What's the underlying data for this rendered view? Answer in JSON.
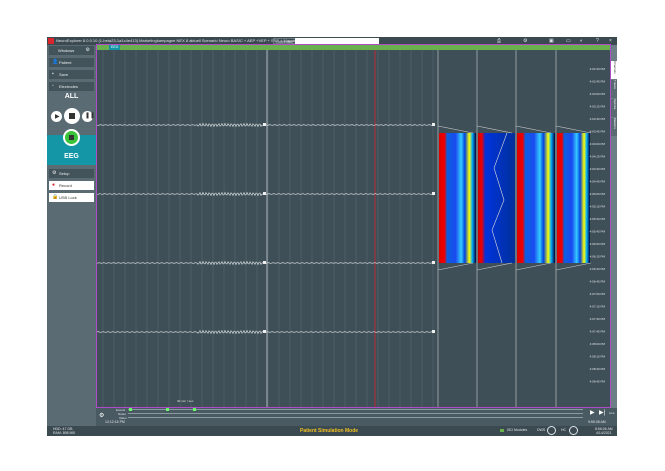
{
  "titlebar": {
    "title": "NeuroExplorer 8.0.0.10 (1-beta23-1a1c4e413)   Marketingkampagne NEX 8 aktuell Scenario Neuro BASIC + AEP +VEP + SSS + Mapping",
    "comment_label": "Comment ▾",
    "comment_value": ""
  },
  "sidebar": {
    "windows": "Windows",
    "patient": "Patient",
    "save": "Save",
    "electrodes": "Electrodes",
    "all": "ALL",
    "eeg": "EEG",
    "setup": "Setup",
    "record": "Record",
    "usb_lock": "USB Lock"
  },
  "chart": {
    "tab": "EEG",
    "scale": "30 mm / sec",
    "time_labels": [
      "4:02:30 PM",
      "4:02:45 PM",
      "4:03:00 PM",
      "4:03:15 PM",
      "4:03:30 PM",
      "4:03:45 PM",
      "4:04:00 PM",
      "4:04:15 PM",
      "4:04:30 PM",
      "4:04:45 PM",
      "4:05:00 PM",
      "4:05:15 PM",
      "4:05:30 PM",
      "4:05:45 PM",
      "4:06:00 PM",
      "4:06:15 PM",
      "4:06:30 PM",
      "4:06:45 PM",
      "4:07:00 PM",
      "4:07:15 PM",
      "4:07:30 PM",
      "4:07:45 PM",
      "4:08:00 PM",
      "4:08:15 PM",
      "4:08:30 PM",
      "4:08:45 PM"
    ]
  },
  "right_tabs": [
    "Channels",
    "Traces",
    "Spectra",
    "Markers"
  ],
  "bottom": {
    "events": "Events",
    "notes": "Notes",
    "video": "Video",
    "time": "12:12:15 PM",
    "live": "Live",
    "live_time": "9:55:38 AM"
  },
  "status": {
    "hdd": "HDD: 47 GB",
    "ram": "RAM: 898 MB",
    "mode": "Patient Simulation Mode",
    "iso": "ISO Modules",
    "dws": "DWS",
    "hc": "HC",
    "clock": "8:56:06 AM",
    "date": "4/14/2021"
  },
  "colors": {
    "accent_green": "#6ab04c",
    "teal": "#1596a6",
    "marker_red": "#d8262c",
    "frame": "#b04ac8"
  }
}
